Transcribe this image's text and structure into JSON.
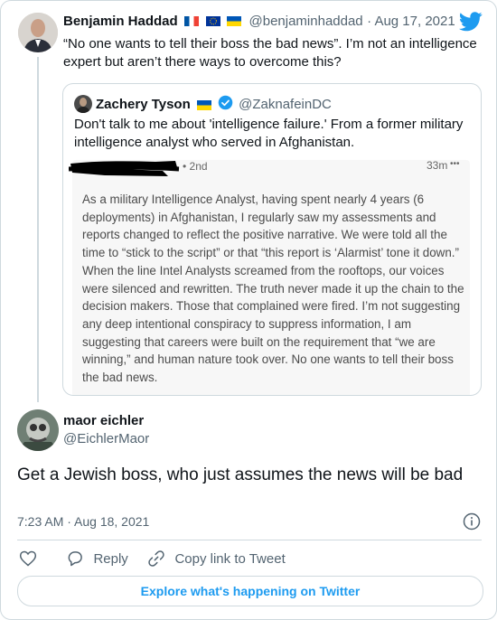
{
  "main_tweet": {
    "author_name": "Benjamin Haddad",
    "author_handle": "@benjaminhaddad",
    "date": "· Aug 17, 2021",
    "text": "“No one wants to tell their boss the bad news”. I’m not an intelligence expert but aren’t there ways to overcome this?"
  },
  "quoted_tweet": {
    "author_name": "Zachery Tyson",
    "author_handle": "@ZaknafeinDC",
    "text": "Don't talk to me about 'intelligence failure.' From a former military intelligence analyst who served in Afghanistan.",
    "screenshot": {
      "degree": "• 2nd",
      "time": "33m",
      "more": "•••",
      "body": "As a military Intelligence Analyst, having spent nearly 4 years (6 deployments) in Afghanistan, I regularly saw my assessments and reports changed to reflect the positive narrative. We were told all the time to “stick to the script” or that “this report is ‘Alarmist’ tone it down.” When the line Intel Analysts screamed from the rooftops, our voices were silenced and rewritten. The truth never made it up the chain to the decision makers. Those that complained were fired. I’m not suggesting any deep intentional conspiracy to suppress information, I am suggesting that careers were built on the requirement that “we are winning,” and human nature took over. No one wants to tell their boss the bad news."
    }
  },
  "reply_tweet": {
    "author_name": "maor eichler",
    "author_handle": "@EichlerMaor",
    "text": "Get a Jewish boss, who just assumes the news will be bad",
    "timestamp": "7:23 AM · Aug 18, 2021"
  },
  "actions": {
    "reply_label": "Reply",
    "copy_label": "Copy link to Tweet"
  },
  "explore_label": "Explore what's happening on Twitter",
  "colors": {
    "twitter_blue": "#1d9bf0",
    "verified": "#1d9bf0"
  },
  "icons": [
    "twitter-bird-icon",
    "verified-badge-icon",
    "info-icon",
    "heart-icon",
    "reply-icon",
    "link-icon"
  ]
}
